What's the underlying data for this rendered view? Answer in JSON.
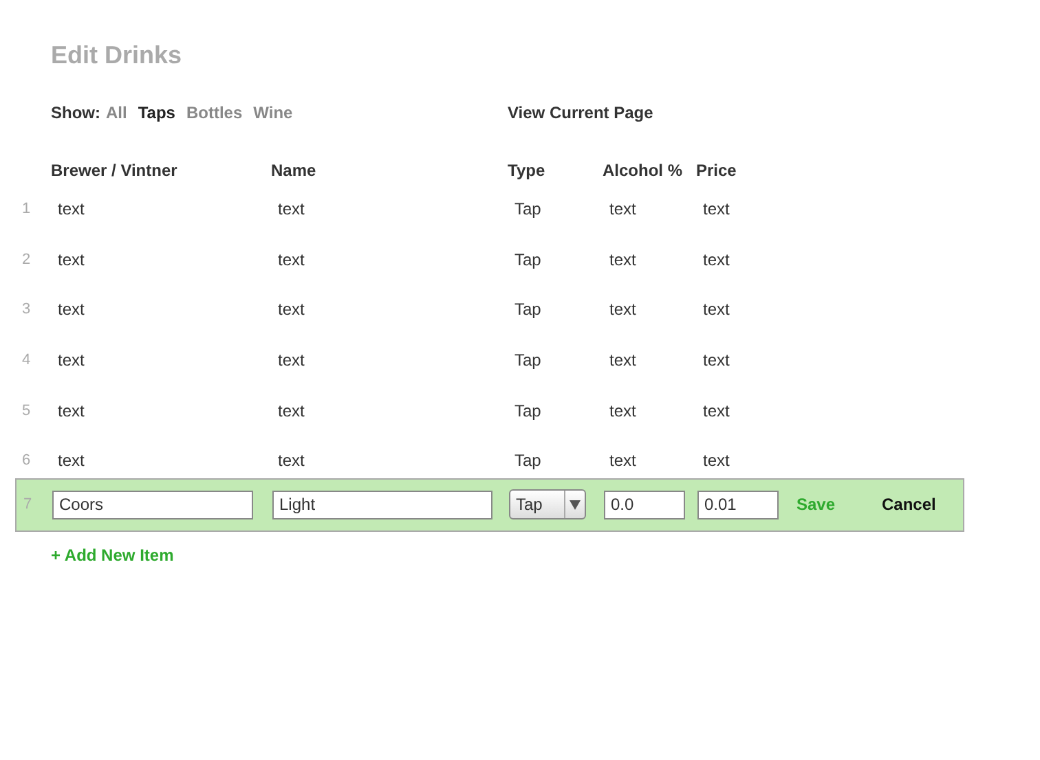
{
  "title": "Edit Drinks",
  "filter": {
    "label": "Show:",
    "options": [
      {
        "label": "All",
        "selected": false
      },
      {
        "label": "Taps",
        "selected": true
      },
      {
        "label": "Bottles",
        "selected": false
      },
      {
        "label": "Wine",
        "selected": false
      }
    ]
  },
  "view_link": "View Current Page",
  "table": {
    "columns": [
      "Brewer / Vintner",
      "Name",
      "Type",
      "Alcohol %",
      "Price"
    ],
    "rows": [
      {
        "number": "1",
        "cells": [
          "text",
          "text",
          "Tap",
          "text",
          "text"
        ]
      },
      {
        "number": "2",
        "cells": [
          "text",
          "text",
          "Tap",
          "text",
          "text"
        ]
      },
      {
        "number": "3",
        "cells": [
          "text",
          "text",
          "Tap",
          "text",
          "text"
        ]
      },
      {
        "number": "4",
        "cells": [
          "text",
          "text",
          "Tap",
          "text",
          "text"
        ]
      },
      {
        "number": "5",
        "cells": [
          "text",
          "text",
          "Tap",
          "text",
          "text"
        ]
      },
      {
        "number": "6",
        "cells": [
          "text",
          "text",
          "Tap",
          "text",
          "text"
        ]
      }
    ],
    "edit_row": {
      "number": "7",
      "brewer": "Coors",
      "name": "Light",
      "type": "Tap",
      "alcohol": "0.0",
      "price": "0.01",
      "save": "Save",
      "cancel": "Cancel"
    }
  },
  "add_link": "+ Add New Item"
}
